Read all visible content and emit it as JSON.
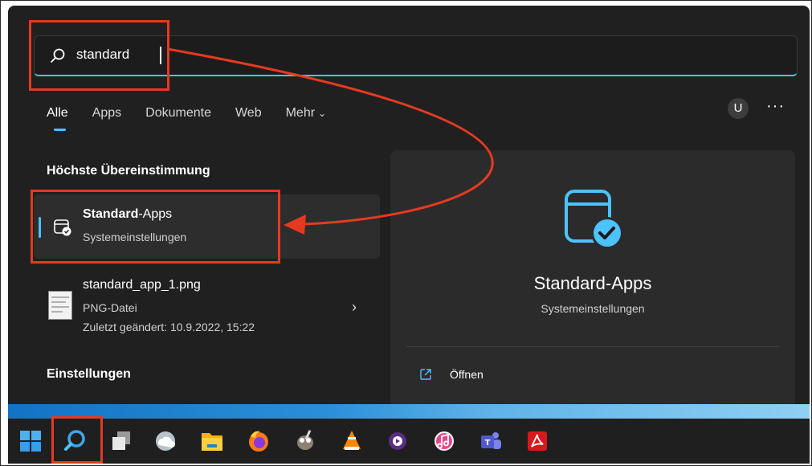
{
  "search": {
    "value": "standard"
  },
  "tabs": [
    {
      "label": "Alle"
    },
    {
      "label": "Apps"
    },
    {
      "label": "Dokumente"
    },
    {
      "label": "Web"
    },
    {
      "label": "Mehr"
    }
  ],
  "header": {
    "avatar_letter": "U",
    "more": "···"
  },
  "best_match": {
    "heading": "Höchste Übereinstimmung",
    "title_bold": "Standard",
    "title_rest": "-Apps",
    "subtitle": "Systemeinstellungen"
  },
  "file_result": {
    "title": "standard_app_1.png",
    "type": "PNG-Datei",
    "modified": "Zuletzt geändert: 10.9.2022, 15:22"
  },
  "settings_heading": "Einstellungen",
  "detail": {
    "name": "Standard-Apps",
    "kind": "Systemeinstellungen",
    "open_label": "Öffnen"
  },
  "colors": {
    "accent": "#4cc2ff",
    "annotation_red": "#e53a20"
  },
  "taskbar_icons": [
    "windows-start-icon",
    "search-icon",
    "task-view-icon",
    "onedrive-icon",
    "file-explorer-icon",
    "firefox-icon",
    "gimp-icon",
    "vlc-icon",
    "media-player-icon",
    "itunes-icon",
    "teams-icon",
    "acrobat-icon"
  ]
}
